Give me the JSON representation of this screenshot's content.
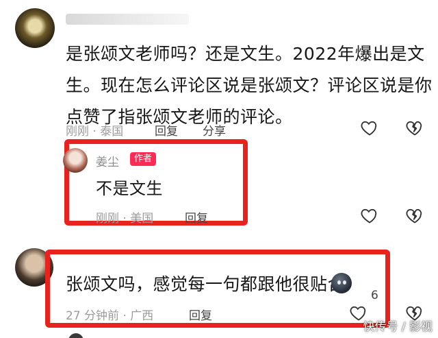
{
  "comment1": {
    "lines": [
      "是张颂文老师吗？还是文生。2022年爆出是文",
      "生。现在怎么评论区说是张颂文？评论区说是你",
      "点赞了指张颂文老师的评论。"
    ],
    "time_location": "刚刚 · 泰国",
    "reply_label": "回复",
    "share_label": "分享"
  },
  "reply1": {
    "author": "姜尘",
    "author_badge": "作者",
    "text": "不是文生",
    "time_location": "刚刚 · 美国",
    "reply_label": "回复"
  },
  "comment2": {
    "text": "张颂文吗，感觉每一句都跟他很贴合",
    "time_location": "27 分钟前 · 广西",
    "reply_label": "回复",
    "like_count": "6"
  },
  "watermark": "快传号 / 影视",
  "colors": {
    "highlight": "#e8231e",
    "badge": "#fe2c55"
  },
  "icons": [
    "heart-outline-icon",
    "broken-heart-icon"
  ]
}
